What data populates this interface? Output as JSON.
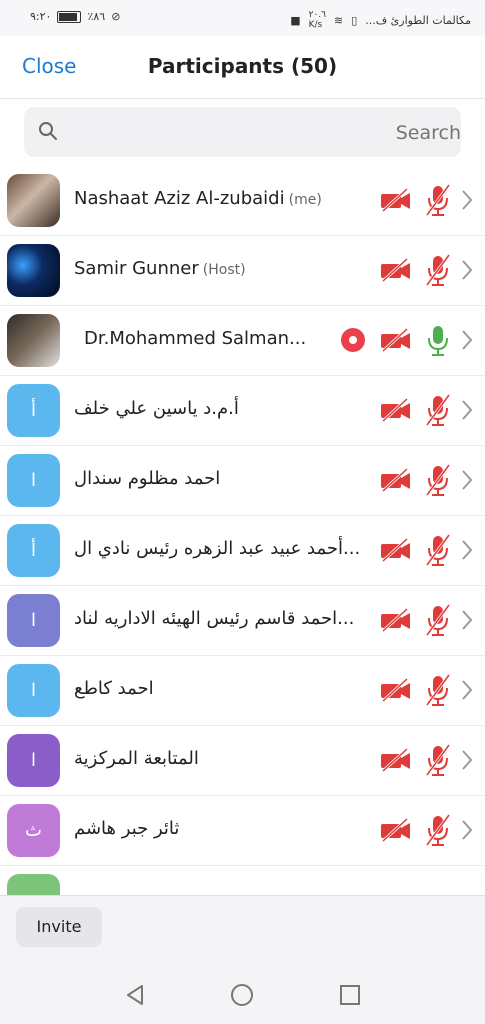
{
  "status_bar": {
    "time": "٩:٢٠",
    "battery_text": "٪٨٦",
    "speed_value": "٢٠.٦",
    "speed_unit": "K/s",
    "carrier": "مكالمات الطوارئ ف..."
  },
  "header": {
    "close_label": "Close",
    "title": "Participants (50)"
  },
  "search": {
    "placeholder": "Search"
  },
  "colors": {
    "accent": "#1f7ad1",
    "muted_red": "#e03b3b",
    "mic_on_green": "#4caf50",
    "record_red": "#e9404c"
  },
  "participants": [
    {
      "name": "Nashaat Aziz Al-zubaidi",
      "tag": "(me)",
      "avatar": "photo",
      "video": "off",
      "audio": "muted"
    },
    {
      "name": "Samir Gunner",
      "tag": "(Host)",
      "avatar": "photo",
      "video": "off",
      "audio": "muted"
    },
    {
      "name": "Dr.Mohammed Salman...",
      "tag": "",
      "avatar": "photo",
      "video": "off",
      "audio": "on",
      "recording": true
    },
    {
      "name": "أ.م.د ياسين علي خلف",
      "tag": "",
      "avatar_letter": "أ",
      "avatar_color": "#5bb7ee",
      "video": "off",
      "audio": "muted"
    },
    {
      "name": "احمد  مظلوم سندال",
      "tag": "",
      "avatar_letter": "ا",
      "avatar_color": "#5bb7ee",
      "video": "off",
      "audio": "muted"
    },
    {
      "name": "أحمد عبيد عبد الزهره رئيس نادي ال...",
      "tag": "",
      "avatar_letter": "أ",
      "avatar_color": "#5bb7ee",
      "video": "off",
      "audio": "muted"
    },
    {
      "name": "احمد قاسم رئيس الهيئه الاداريه لناد...",
      "tag": "",
      "avatar_letter": "ا",
      "avatar_color": "#7b7fd1",
      "video": "off",
      "audio": "muted"
    },
    {
      "name": "احمد كاطع",
      "tag": "",
      "avatar_letter": "ا",
      "avatar_color": "#5bb7ee",
      "video": "off",
      "audio": "muted"
    },
    {
      "name": "المتابعة المركزية",
      "tag": "",
      "avatar_letter": "ا",
      "avatar_color": "#8a5dc9",
      "video": "off",
      "audio": "muted"
    },
    {
      "name": "ثائر جبر هاشم",
      "tag": "",
      "avatar_letter": "ث",
      "avatar_color": "#c07bd8",
      "video": "off",
      "audio": "muted"
    }
  ],
  "footer": {
    "invite_label": "Invite"
  },
  "nav": {
    "icons": [
      "back-icon",
      "home-icon",
      "recents-icon"
    ]
  }
}
